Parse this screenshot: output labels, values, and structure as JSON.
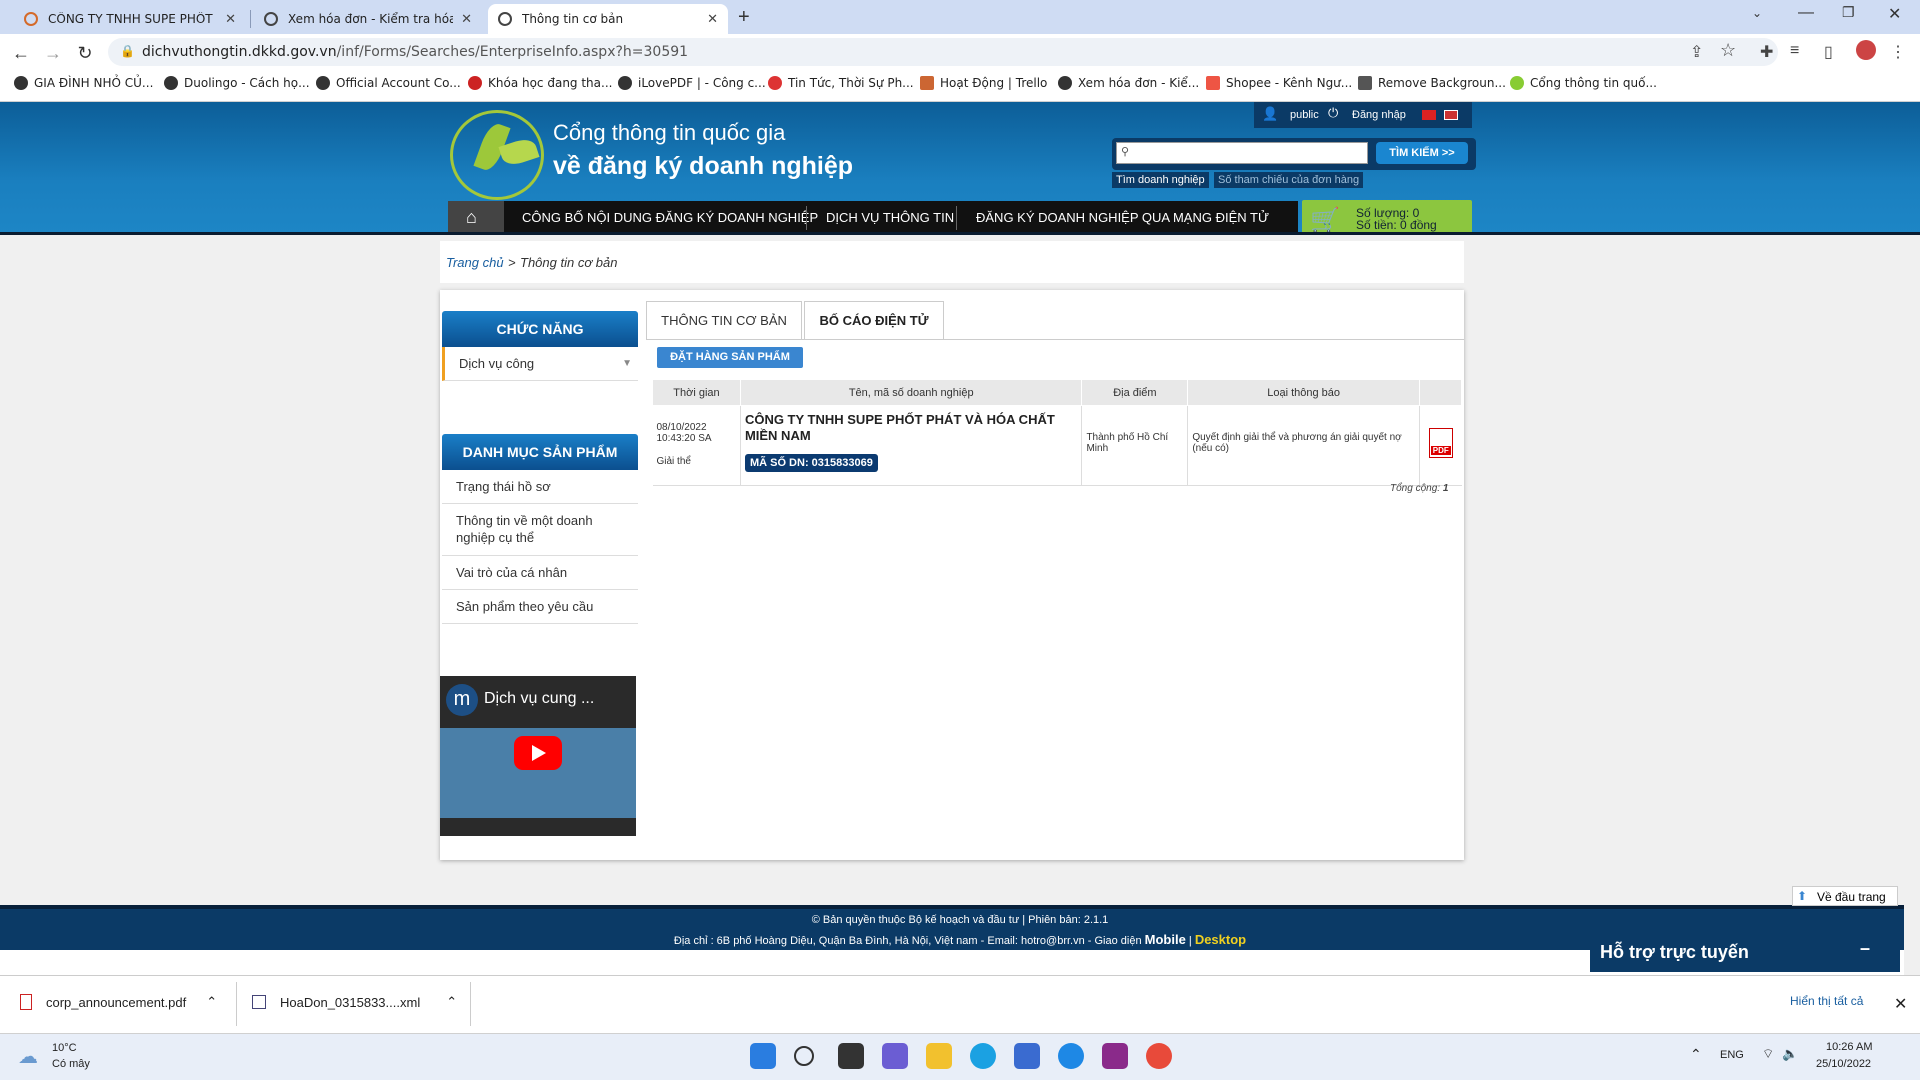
{
  "browser": {
    "tabs": [
      {
        "title": "CÔNG TY TNHH SUPE PHỐT PHÁ",
        "active": false
      },
      {
        "title": "Xem hóa đơn - Kiểm tra hóa đơ",
        "active": false
      },
      {
        "title": "Thông tin cơ bản",
        "active": true
      }
    ],
    "url_host": "dichvuthongtin.dkkd.gov.vn",
    "url_path": "/inf/Forms/Searches/EnterpriseInfo.aspx?h=30591",
    "bookmarks": [
      "GIA ĐÌNH NHỎ CỦ...",
      "Duolingo - Cách họ...",
      "Official Account Co...",
      "Khóa học đang tha...",
      "iLovePDF | - Công c...",
      "Tin Tức, Thời Sự Ph...",
      "Hoạt Động | Trello",
      "Xem hóa đơn - Kiể...",
      "Shopee - Kênh Ngư...",
      "Remove Backgroun...",
      "Cổng thông tin quố..."
    ]
  },
  "header": {
    "brand_line1": "Cổng thông tin quốc gia",
    "brand_line2": "về đăng ký doanh nghiệp",
    "user": "public",
    "login": "Đăng nhập",
    "search_button": "TÌM KIẾM >>",
    "search_tab_active": "Tìm doanh nghiệp",
    "search_tab_inactive": "Số tham chiếu của đơn hàng",
    "nav": [
      "CÔNG BỐ NỘI DUNG ĐĂNG KÝ DOANH NGHIỆP",
      "DỊCH VỤ THÔNG TIN",
      "ĐĂNG KÝ DOANH NGHIỆP QUA MẠNG ĐIỆN TỬ"
    ],
    "cart_qty": "Số lượng: 0",
    "cart_amount": "Số tiền: 0 đồng"
  },
  "breadcrumb": {
    "home": "Trang chủ",
    "sep": ">",
    "current": "Thông tin cơ bản"
  },
  "sidebar": {
    "functions_title": "CHỨC NĂNG",
    "functions_select": "Dịch vụ công",
    "catalog_title": "DANH MỤC SẢN PHẨM",
    "catalog_items": [
      "Trạng thái hồ sơ",
      "Thông tin về một doanh nghiệp cụ thể",
      "Vai trò của cá nhân",
      "Sản phẩm theo yêu cầu"
    ],
    "video_title": "Dịch vụ cung ..."
  },
  "main": {
    "tabs": [
      "THÔNG TIN CƠ BẢN",
      "BỐ CÁO ĐIỆN TỬ"
    ],
    "order_button": "ĐẶT HÀNG SẢN PHẨM",
    "columns": [
      "Thời gian",
      "Tên, mã số doanh nghiệp",
      "Địa điểm",
      "Loại thông báo",
      ""
    ],
    "row": {
      "date": "08/10/2022",
      "time": "10:43:20 SA",
      "status": "Giải thể",
      "company": "CÔNG TY TNHH SUPE PHỐT PHÁT VÀ HÓA CHẤT MIỀN NAM",
      "code": "MÃ SỐ DN: 0315833069",
      "location": "Thành phố Hồ Chí Minh",
      "notice": "Quyết định giải thể và phương án giải quyết nợ (nếu có)",
      "file_icon": "PDF"
    },
    "total_label": "Tổng cộng:",
    "total_value": "1"
  },
  "footer": {
    "line1": "© Bản quyền thuộc Bộ kế hoạch và đầu tư | Phiên bản: 2.1.1",
    "line2": "Địa chỉ : 6B phố Hoàng Diệu, Quận Ba Đình, Hà Nội, Việt nam - Email: hotro@brr.vn - Giao diện",
    "mobile": "Mobile",
    "sep": "|",
    "desktop": "Desktop",
    "back_to_top": "Về đầu trang",
    "support": "Hỗ trợ trực tuyến"
  },
  "downloads": {
    "items": [
      "corp_announcement.pdf",
      "HoaDon_0315833....xml"
    ],
    "show_all": "Hiển thị tất cả"
  },
  "taskbar": {
    "weather_temp": "10°C",
    "weather_desc": "Có mây",
    "lang": "ENG",
    "time": "10:26 AM",
    "date": "25/10/2022"
  }
}
